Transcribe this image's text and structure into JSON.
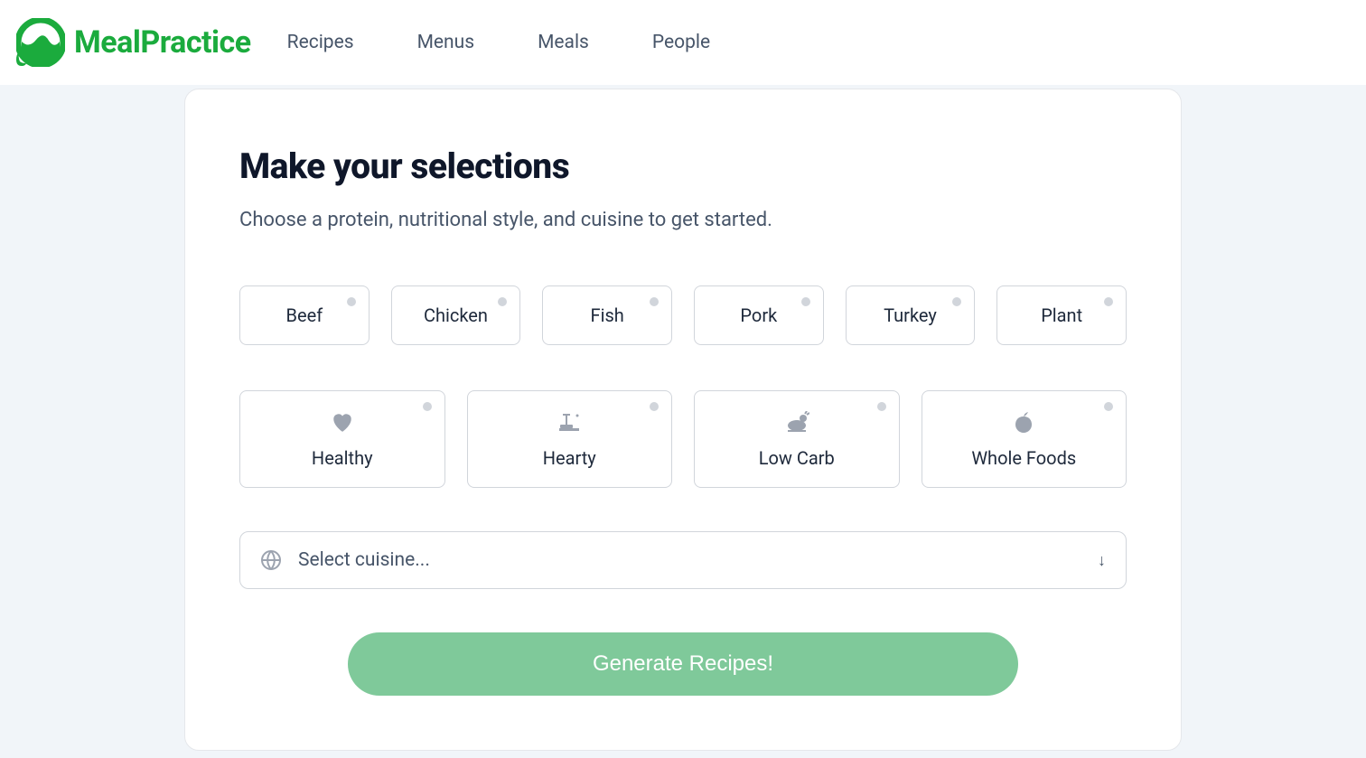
{
  "brand": {
    "name": "MealPractice"
  },
  "nav": {
    "items": [
      {
        "label": "Recipes"
      },
      {
        "label": "Menus"
      },
      {
        "label": "Meals"
      },
      {
        "label": "People"
      }
    ]
  },
  "page": {
    "title": "Make your selections",
    "subtitle": "Choose a protein, nutritional style, and cuisine to get started.",
    "generate_label": "Generate Recipes!"
  },
  "protein": {
    "options": [
      {
        "label": "Beef"
      },
      {
        "label": "Chicken"
      },
      {
        "label": "Fish"
      },
      {
        "label": "Pork"
      },
      {
        "label": "Turkey"
      },
      {
        "label": "Plant"
      }
    ]
  },
  "style": {
    "options": [
      {
        "label": "Healthy",
        "icon": "heart-icon"
      },
      {
        "label": "Hearty",
        "icon": "meal-icon"
      },
      {
        "label": "Low Carb",
        "icon": "poultry-icon"
      },
      {
        "label": "Whole Foods",
        "icon": "apple-icon"
      }
    ]
  },
  "cuisine": {
    "placeholder": "Select cuisine..."
  }
}
